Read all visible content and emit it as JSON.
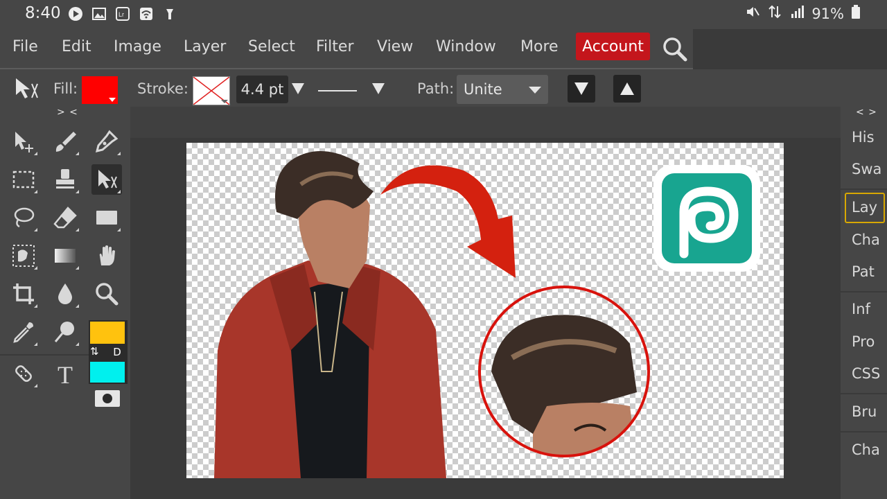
{
  "status_bar": {
    "time": "8:40",
    "battery": "91%",
    "left_icons": [
      "play-icon",
      "gallery-icon",
      "lightroom-icon",
      "wifi-icon",
      "flashlight-icon"
    ],
    "right_icons": [
      "mute-icon",
      "data-icon",
      "signal-icon",
      "battery-icon"
    ]
  },
  "menu": {
    "items": [
      "File",
      "Edit",
      "Image",
      "Layer",
      "Select",
      "Filter",
      "View",
      "Window",
      "More"
    ],
    "account": "Account",
    "account_color": "#c4161c"
  },
  "options": {
    "fill_label": "Fill:",
    "fill_color": "#ff0000",
    "stroke_label": "Stroke:",
    "stroke_value": "4.4 pt",
    "path_label": "Path:",
    "path_value": "Unite"
  },
  "toolbox": {
    "collapse": "> <",
    "foreground_color": "#ffc20e",
    "background_color": "#00f0ee",
    "swap_label": "D"
  },
  "right_panel": {
    "collapse": "< >",
    "items": [
      "His",
      "Swa",
      "Lay",
      "Cha",
      "Pat",
      "Inf",
      "Pro",
      "CSS",
      "Bru",
      "Cha"
    ],
    "active": "Lay"
  }
}
